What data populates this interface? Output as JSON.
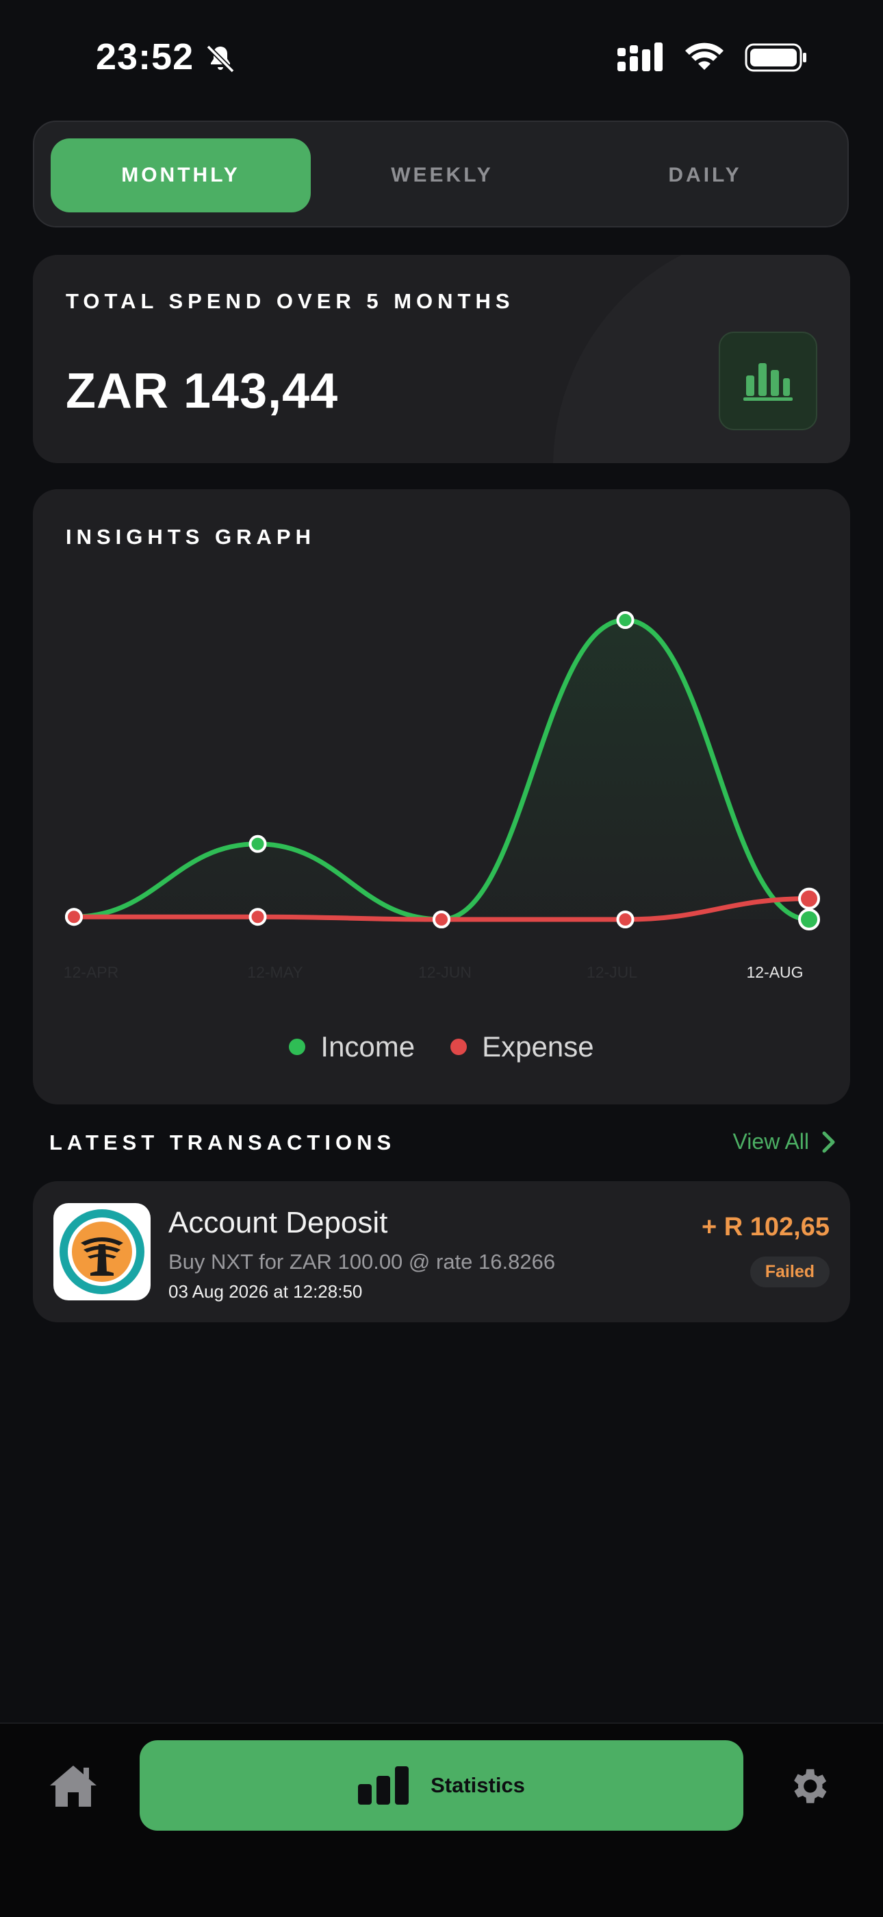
{
  "status_bar": {
    "time": "23:52"
  },
  "period_tabs": [
    {
      "label": "MONTHLY",
      "active": true
    },
    {
      "label": "WEEKLY",
      "active": false
    },
    {
      "label": "DAILY",
      "active": false
    }
  ],
  "total_card": {
    "title": "TOTAL SPEND OVER 5 MONTHS",
    "amount": "ZAR 143,44",
    "icon": "bar-chart-icon"
  },
  "insights": {
    "title": "INSIGHTS GRAPH",
    "x_labels": [
      "12-APR",
      "12-MAY",
      "12-JUN",
      "12-JUL",
      "12-AUG"
    ],
    "legend": {
      "income": "Income",
      "expense": "Expense"
    }
  },
  "chart_data": {
    "type": "line",
    "categories": [
      "12-APR",
      "12-MAY",
      "12-JUN",
      "12-JUL",
      "12-AUG"
    ],
    "series": [
      {
        "name": "Income",
        "color": "#2fbd55",
        "values": [
          1,
          29,
          0,
          115,
          0
        ]
      },
      {
        "name": "Expense",
        "color": "#e04848",
        "values": [
          1,
          1,
          0,
          0,
          8
        ]
      }
    ],
    "ylim": [
      0,
      120
    ],
    "legend": "bottom-center",
    "grid": false
  },
  "latest_transactions": {
    "title": "LATEST TRANSACTIONS",
    "view_all": "View All",
    "items": [
      {
        "title": "Account Deposit",
        "description": "Buy NXT for ZAR 100.00 @ rate 16.8266",
        "date": "03 Aug 2026 at 12:28:50",
        "amount": "+ R 102,65",
        "status": "Failed",
        "logo": "bank-tree-logo"
      }
    ]
  },
  "bottom_nav": {
    "home_icon": "home-icon",
    "stats_label": "Statistics",
    "settings_icon": "gear-icon"
  },
  "colors": {
    "accent": "#4caf64",
    "income": "#2fbd55",
    "expense": "#e04848",
    "warning": "#f0984a"
  }
}
